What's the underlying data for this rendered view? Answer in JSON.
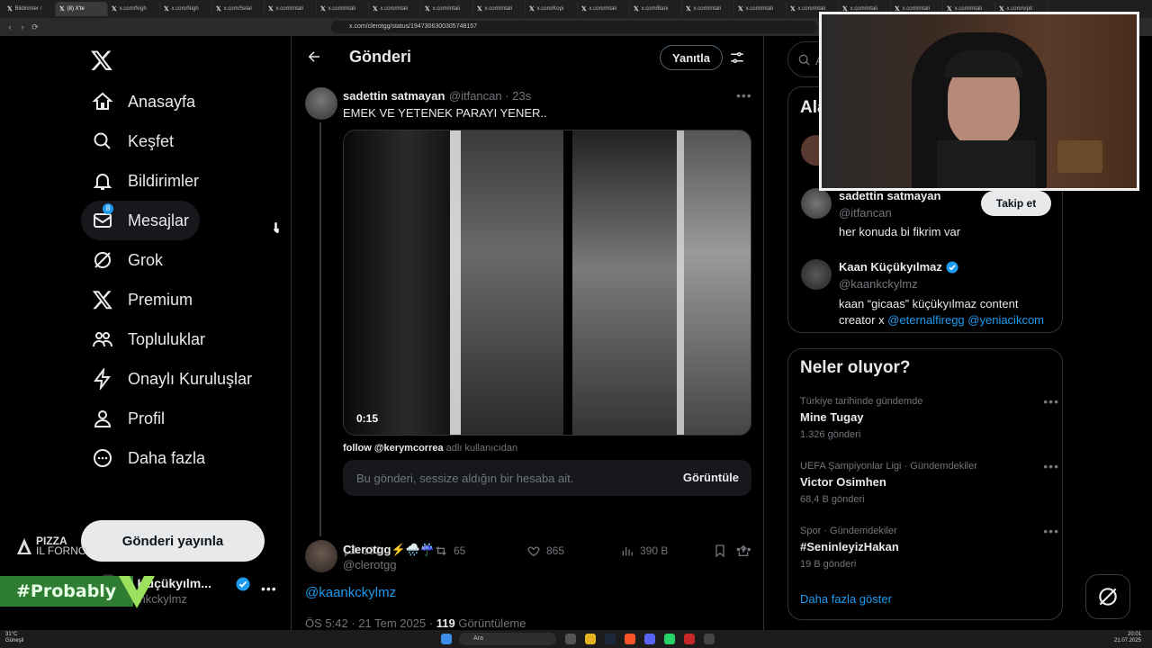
{
  "browser": {
    "tabs": [
      "Bildirimler /",
      "(8) X'te",
      "x.com/Nigh",
      "x.com/Nigh",
      "x.com/Selal",
      "x.com/mtali",
      "x.com/mtali",
      "x.com/mtali",
      "x.com/mtali",
      "x.com/mtali",
      "x.com/Kopi",
      "x.com/mtali",
      "x.com/Bani",
      "x.com/mtali",
      "x.com/mtali",
      "x.com/mtali",
      "x.com/mtali",
      "x.com/mtali",
      "x.com/mtali",
      "x.com/vipit"
    ],
    "url": "x.com/clerotgg/status/1947306300305748157"
  },
  "nav": {
    "items": [
      {
        "label": "Anasayfa",
        "icon": "home-icon"
      },
      {
        "label": "Keşfet",
        "icon": "search-icon"
      },
      {
        "label": "Bildirimler",
        "icon": "bell-icon"
      },
      {
        "label": "Mesajlar",
        "icon": "mail-icon"
      },
      {
        "label": "Grok",
        "icon": "grok-icon"
      },
      {
        "label": "Premium",
        "icon": "x-logo-icon"
      },
      {
        "label": "Topluluklar",
        "icon": "people-icon"
      },
      {
        "label": "Onaylı Kuruluşlar",
        "icon": "bolt-icon"
      },
      {
        "label": "Profil",
        "icon": "person-icon"
      },
      {
        "label": "Daha fazla",
        "icon": "more-circle-icon"
      }
    ],
    "notif_count": "8",
    "post_button": "Gönderi yayınla",
    "account_name": "n Küçükyılm...",
    "account_handle": "aankckylmz"
  },
  "overlay": {
    "pizza_line1": "PIZZA",
    "pizza_line2": "IL FORNO",
    "probably": "#Probably"
  },
  "center": {
    "header_title": "Gönderi",
    "reply_button": "Yanıtla",
    "quoted": {
      "name": "sadettin satmayan",
      "handle": "@itfancan · 23s",
      "text": "EMEK VE YETENEK PARAYI YENER..",
      "video_time": "0:15"
    },
    "follow_note_user": "follow @kerymcorrea",
    "follow_note_rest": " adlı kullanıcıdan",
    "muted_text": "Bu gönderi, sessize aldığın bir hesaba ait.",
    "muted_button": "Görüntüle",
    "stats": {
      "replies": "137",
      "reposts": "65",
      "likes": "865",
      "views": "390 B"
    },
    "reply": {
      "name": "Clerotgg⚡🌧️☔",
      "handle": "@clerotgg",
      "text": "@kaankckylmz",
      "time": "ÖS 5:42 · 21 Tem 2025 · ",
      "views_count": "119",
      "views_label": " Görüntüleme"
    }
  },
  "right": {
    "search_placeholder": "A",
    "section_title": "Ala",
    "relevant": [
      {
        "name": "sadettin satmayan",
        "handle": "@itfancan",
        "bio": "her konuda bi fikrim var",
        "button": "Takip et"
      },
      {
        "name": "Kaan Küçükyılmaz",
        "handle": "@kaankckylmz",
        "bio_pre": "kaan “gicaas” küçükyılmaz content creator x ",
        "link1": "@eternalfiregg",
        "link2": "@yeniacikcom"
      }
    ],
    "trends_title": "Neler oluyor?",
    "trends": [
      {
        "meta": "Türkiye tarihinde gündemde",
        "title": "Mine Tugay",
        "count": "1.326 gönderi"
      },
      {
        "meta": "UEFA Şampiyonlar Ligi · Gündemdekiler",
        "title": "Victor Osimhen",
        "count": "68,4 B gönderi"
      },
      {
        "meta": "Spor · Gündemdekiler",
        "title": "#SeninleyizHakan",
        "count": "19 B gönderi"
      }
    ],
    "show_more": "Daha fazla göster"
  },
  "taskbar": {
    "weather_temp": "31°C",
    "weather_desc": "Güneşli",
    "search": "Ara",
    "time": "20:01",
    "date": "21.07.2025"
  },
  "colors": {
    "accent": "#1d9bf0",
    "background": "#000000",
    "border": "#2f3336",
    "muted": "#71767b"
  }
}
